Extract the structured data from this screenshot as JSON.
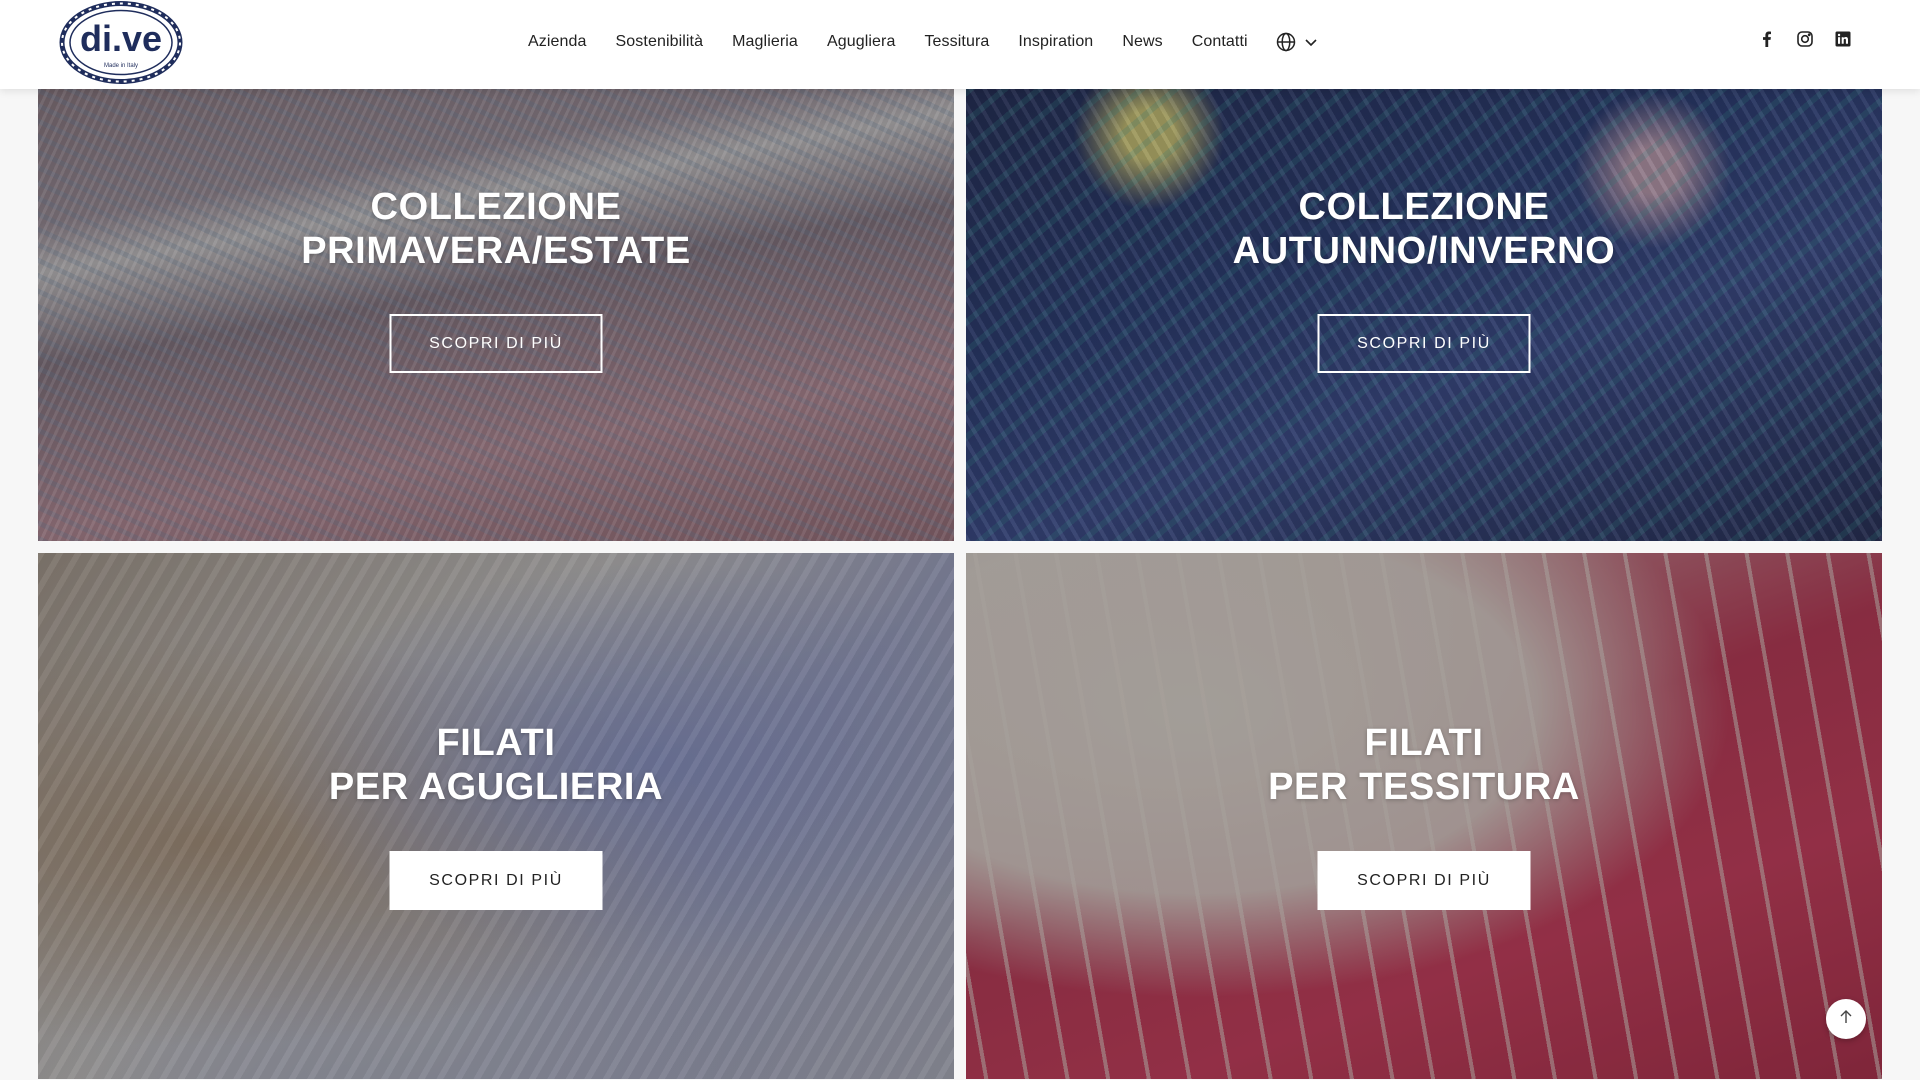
{
  "header": {
    "logo": {
      "text": "di.ve",
      "tagline": "Made in Italy",
      "icon": "dive-logo"
    },
    "nav": [
      {
        "label": "Azienda"
      },
      {
        "label": "Sostenibilità"
      },
      {
        "label": "Maglieria"
      },
      {
        "label": "Agugliera"
      },
      {
        "label": "Tessitura"
      },
      {
        "label": "Inspiration"
      },
      {
        "label": "News"
      },
      {
        "label": "Contatti"
      }
    ],
    "language": {
      "icon": "globe-icon",
      "dropdown_icon": "chevron-down-icon"
    },
    "social": [
      {
        "name": "facebook-icon"
      },
      {
        "name": "instagram-icon"
      },
      {
        "name": "linkedin-icon"
      }
    ]
  },
  "tiles": [
    {
      "title_line1": "COLLEZIONE",
      "title_line2": "PRIMAVERA/ESTATE",
      "button": "SCOPRI DI PIÙ",
      "button_style": "outline"
    },
    {
      "title_line1": "COLLEZIONE",
      "title_line2": "AUTUNNO/INVERNO",
      "button": "SCOPRI DI PIÙ",
      "button_style": "outline"
    },
    {
      "title_line1": "FILATI",
      "title_line2": "PER AGUGLIERIA",
      "button": "SCOPRI DI PIÙ",
      "button_style": "solid"
    },
    {
      "title_line1": "FILATI",
      "title_line2": "PER TESSITURA",
      "button": "SCOPRI DI PIÙ",
      "button_style": "solid"
    }
  ],
  "back_to_top": {
    "icon": "arrow-up-icon"
  },
  "colors": {
    "logo_navy": "#1f2d5c",
    "header_bg": "#ffffff",
    "text": "#222222"
  }
}
